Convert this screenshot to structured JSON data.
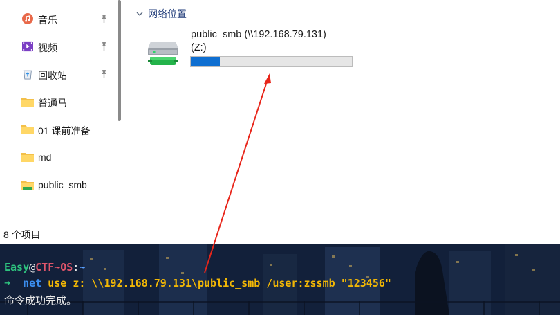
{
  "sidebar": {
    "items": [
      {
        "label": "音乐",
        "icon": "music-icon",
        "pinned": true
      },
      {
        "label": "视频",
        "icon": "video-icon",
        "pinned": true
      },
      {
        "label": "回收站",
        "icon": "recycle-bin-icon",
        "pinned": true
      },
      {
        "label": "普通马",
        "icon": "folder-icon",
        "pinned": false
      },
      {
        "label": "01 课前准备",
        "icon": "folder-icon",
        "pinned": false
      },
      {
        "label": "md",
        "icon": "folder-icon",
        "pinned": false
      },
      {
        "label": "public_smb",
        "icon": "network-folder-icon",
        "pinned": false
      }
    ]
  },
  "main": {
    "group_title": "网络位置",
    "drive": {
      "name_line1": "public_smb (\\\\192.168.79.131)",
      "name_line2": "(Z:)",
      "usage_fraction": 0.18,
      "fill_color": "#0f6fd1"
    }
  },
  "status_bar": {
    "item_count": "8 个项目"
  },
  "terminal": {
    "prompt_user": "Easy",
    "prompt_at": "@",
    "prompt_host": "CTF~OS",
    "prompt_sep": ":",
    "prompt_path": "~",
    "arrow": "➜",
    "command": "net",
    "args": " use z: \\\\192.168.79.131\\public_smb /user:zssmb \"123456\"",
    "output": "命令成功完成。"
  },
  "annotation": {
    "color": "#e8251a"
  }
}
